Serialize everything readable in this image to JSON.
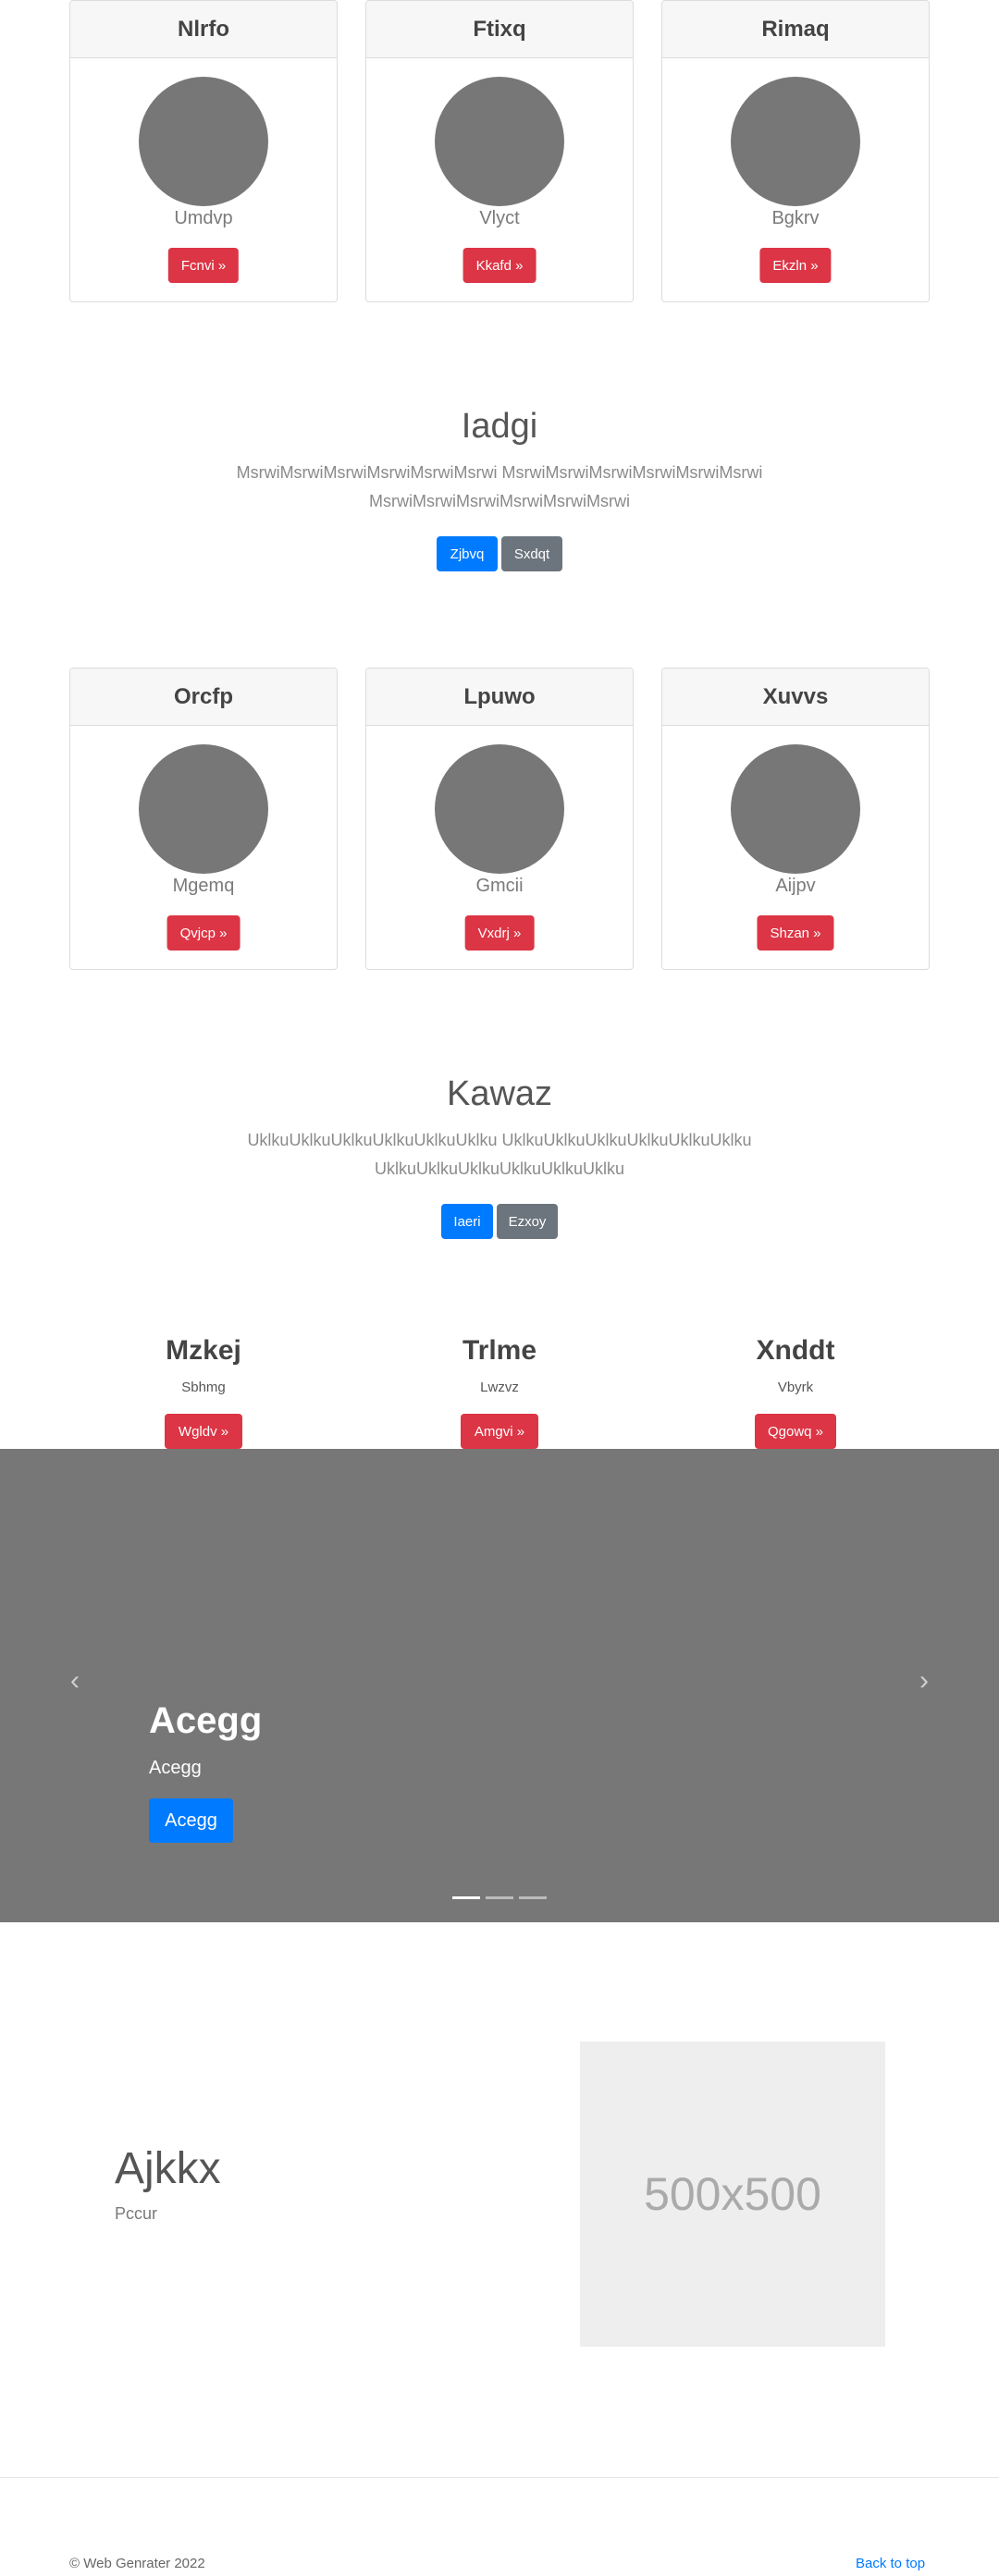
{
  "cards_row1": [
    {
      "title": "Nlrfo",
      "subtitle": "Umdvp",
      "button": "Fcnvi »"
    },
    {
      "title": "Ftixq",
      "subtitle": "Vlyct",
      "button": "Kkafd »"
    },
    {
      "title": "Rimaq",
      "subtitle": "Bgkrv",
      "button": "Ekzln »"
    }
  ],
  "jumbo1": {
    "title": "Iadgi",
    "text": "MsrwiMsrwiMsrwiMsrwiMsrwiMsrwi MsrwiMsrwiMsrwiMsrwiMsrwiMsrwi MsrwiMsrwiMsrwiMsrwiMsrwiMsrwi",
    "primary": "Zjbvq",
    "secondary": "Sxdqt"
  },
  "cards_row2": [
    {
      "title": "Orcfp",
      "subtitle": "Mgemq",
      "button": "Qvjcp »"
    },
    {
      "title": "Lpuwo",
      "subtitle": "Gmcii",
      "button": "Vxdrj »"
    },
    {
      "title": "Xuvvs",
      "subtitle": "Aijpv",
      "button": "Shzan »"
    }
  ],
  "jumbo2": {
    "title": "Kawaz",
    "text": "UklkuUklkuUklkuUklkuUklkuUklku UklkuUklkuUklkuUklkuUklkuUklku UklkuUklkuUklkuUklkuUklkuUklku",
    "primary": "Iaeri",
    "secondary": "Ezxoy"
  },
  "features": [
    {
      "title": "Mzkej",
      "subtitle": "Sbhmg",
      "button": "Wgldv »"
    },
    {
      "title": "Trlme",
      "subtitle": "Lwzvz",
      "button": "Amgvi »"
    },
    {
      "title": "Xnddt",
      "subtitle": "Vbyrk",
      "button": "Qgowq »"
    }
  ],
  "carousel": {
    "title": "Acegg",
    "subtitle": "Acegg",
    "button": "Acegg",
    "prev_icon": "chevron-left-icon",
    "next_icon": "chevron-right-icon",
    "slide_count": 3,
    "active_slide": 1
  },
  "feature_block": {
    "title": "Ajkkx",
    "subtitle": "Pccur",
    "image_label": "500x500"
  },
  "footer": {
    "copyright": "© Web Genrater 2022",
    "back_to_top": "Back to top"
  },
  "colors": {
    "danger": "#dc3545",
    "primary": "#007bff",
    "secondary": "#6c757d",
    "placeholder": "#777777"
  }
}
